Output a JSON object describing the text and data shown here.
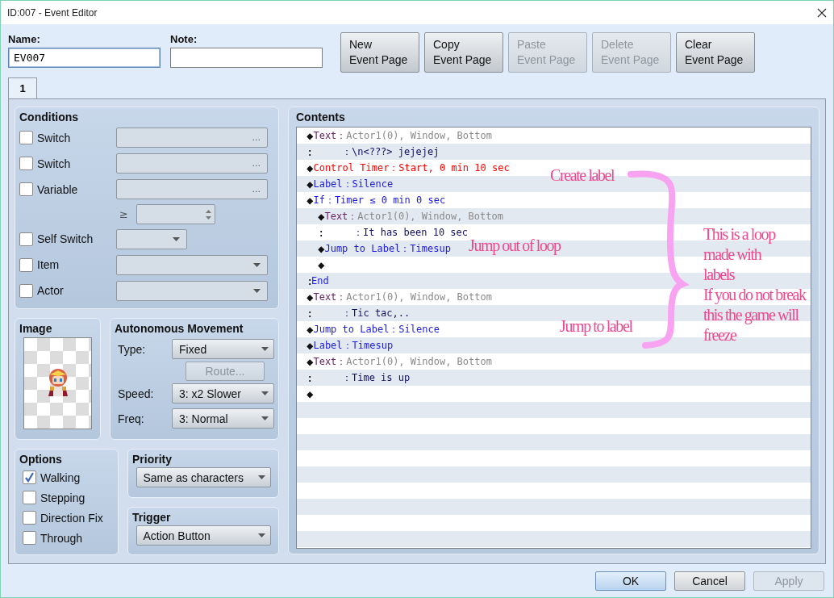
{
  "window": {
    "title": "ID:007 - Event Editor"
  },
  "name_field": {
    "label": "Name:",
    "value": "EV007"
  },
  "note_field": {
    "label": "Note:"
  },
  "page_buttons": [
    {
      "line1": "New",
      "line2": "Event Page",
      "disabled": false
    },
    {
      "line1": "Copy",
      "line2": "Event Page",
      "disabled": false
    },
    {
      "line1": "Paste",
      "line2": "Event Page",
      "disabled": true
    },
    {
      "line1": "Delete",
      "line2": "Event Page",
      "disabled": true
    },
    {
      "line1": "Clear",
      "line2": "Event Page",
      "disabled": false
    }
  ],
  "tabs": [
    {
      "label": "1",
      "selected": true
    }
  ],
  "conditions": {
    "title": "Conditions",
    "rows": [
      {
        "kind": "picker",
        "label": "Switch",
        "checked": false,
        "button_text": "..."
      },
      {
        "kind": "picker",
        "label": "Switch",
        "checked": false,
        "button_text": "..."
      },
      {
        "kind": "picker",
        "label": "Variable",
        "checked": false,
        "button_text": "..."
      },
      {
        "kind": "compare",
        "symbol": "≥"
      },
      {
        "kind": "small-dropdown",
        "label": "Self Switch",
        "checked": false
      },
      {
        "kind": "dropdown",
        "label": "Item",
        "checked": false
      },
      {
        "kind": "dropdown",
        "label": "Actor",
        "checked": false
      }
    ]
  },
  "image": {
    "title": "Image"
  },
  "movement": {
    "title": "Autonomous Movement",
    "type_label": "Type:",
    "type_value": "Fixed",
    "route_button": "Route...",
    "route_disabled": true,
    "speed_label": "Speed:",
    "speed_value": "3: x2 Slower",
    "freq_label": "Freq:",
    "freq_value": "3: Normal"
  },
  "options": {
    "title": "Options",
    "items": [
      {
        "label": "Walking",
        "checked": true
      },
      {
        "label": "Stepping",
        "checked": false
      },
      {
        "label": "Direction Fix",
        "checked": false
      },
      {
        "label": "Through",
        "checked": false
      }
    ]
  },
  "priority": {
    "title": "Priority",
    "value": "Same as characters"
  },
  "trigger": {
    "title": "Trigger",
    "value": "Action Button"
  },
  "contents": {
    "title": "Contents",
    "lines": [
      {
        "kind": "command",
        "marker": "◆",
        "parts": [
          {
            "text": "Text：",
            "kind": "name"
          },
          {
            "text": "Actor1(0), Window, Bottom",
            "kind": "param"
          }
        ]
      },
      {
        "kind": "continuation",
        "marker": ":",
        "parts": [
          {
            "text": "：\\n<???> jejejej",
            "kind": "message"
          }
        ]
      },
      {
        "kind": "command",
        "marker": "◆",
        "parts": [
          {
            "text": "Control Timer：Start, 0 min 10 sec",
            "kind": "timer"
          }
        ]
      },
      {
        "kind": "command",
        "marker": "◆",
        "parts": [
          {
            "text": "Label：Silence",
            "kind": "flow"
          }
        ]
      },
      {
        "kind": "command",
        "marker": "◆",
        "parts": [
          {
            "text": "If：Timer ≤ 0 min 0 sec",
            "kind": "flow"
          }
        ],
        "children": [
          {
            "kind": "command",
            "marker": "◆",
            "parts": [
              {
                "text": "Text：",
                "kind": "name"
              },
              {
                "text": "Actor1(0), Window, Bottom",
                "kind": "param"
              }
            ]
          },
          {
            "kind": "continuation",
            "marker": ":",
            "parts": [
              {
                "text": "：It has been 10 sec",
                "kind": "message"
              }
            ]
          },
          {
            "kind": "command",
            "marker": "◆",
            "parts": [
              {
                "text": "Jump to Label：Timesup",
                "kind": "flow"
              }
            ]
          },
          {
            "kind": "command",
            "marker": "◆"
          }
        ]
      },
      {
        "kind": "end",
        "marker": ":",
        "parts": [
          {
            "text": "End",
            "kind": "flow"
          }
        ]
      },
      {
        "kind": "command",
        "marker": "◆",
        "parts": [
          {
            "text": "Text：",
            "kind": "name"
          },
          {
            "text": "Actor1(0), Window, Bottom",
            "kind": "param"
          }
        ]
      },
      {
        "kind": "continuation",
        "marker": ":",
        "parts": [
          {
            "text": "：Tic tac,..",
            "kind": "message"
          }
        ]
      },
      {
        "kind": "command",
        "marker": "◆",
        "parts": [
          {
            "text": "Jump to Label：Silence",
            "kind": "flow"
          }
        ]
      },
      {
        "kind": "command",
        "marker": "◆",
        "parts": [
          {
            "text": "Label：Timesup",
            "kind": "flow"
          }
        ]
      },
      {
        "kind": "command",
        "marker": "◆",
        "parts": [
          {
            "text": "Text：",
            "kind": "name"
          },
          {
            "text": "Actor1(0), Window, Bottom",
            "kind": "param"
          }
        ]
      },
      {
        "kind": "continuation",
        "marker": ":",
        "parts": [
          {
            "text": "：Time is up",
            "kind": "message"
          }
        ]
      },
      {
        "kind": "command",
        "marker": "◆"
      }
    ],
    "annotations": [
      {
        "lines": [
          "Create label"
        ]
      },
      {
        "lines": [
          "Jump out of loop"
        ]
      },
      {
        "lines": [
          "Jump to label"
        ]
      },
      {
        "lines": [
          "This is a loop",
          "made with",
          "labels",
          "If you do not break",
          "this the game will",
          "freeze"
        ]
      }
    ]
  },
  "dialog_buttons": [
    {
      "label": "OK",
      "kind": "default",
      "disabled": false
    },
    {
      "label": "Cancel",
      "kind": "normal",
      "disabled": false
    },
    {
      "label": "Apply",
      "kind": "normal",
      "disabled": true
    }
  ]
}
